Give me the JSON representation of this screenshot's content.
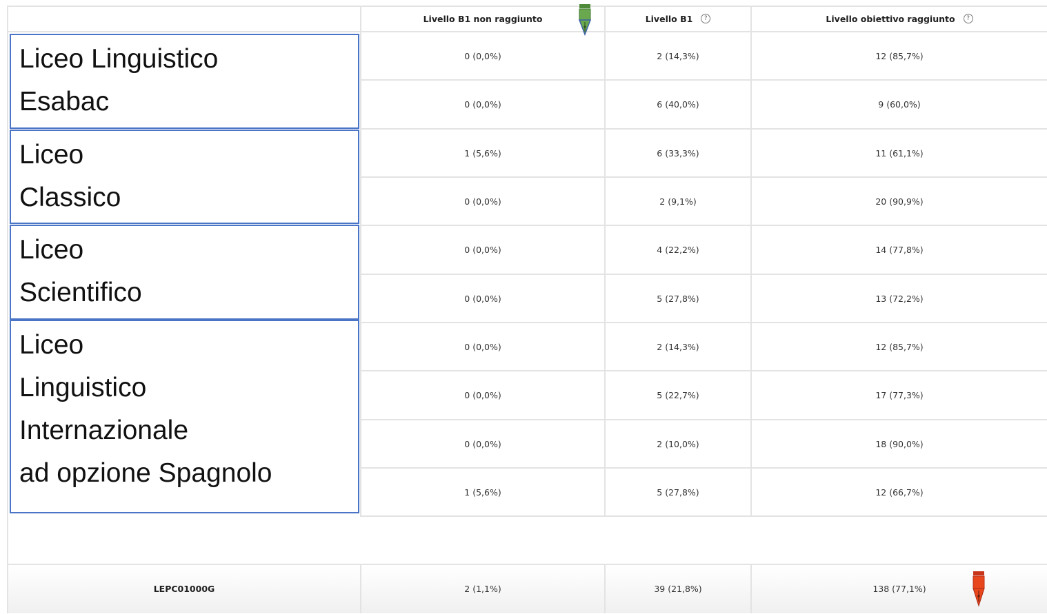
{
  "columns": {
    "col1": "Livello B1 non raggiunto",
    "col2": "Livello B1",
    "col3": "Livello obiettivo raggiunto",
    "help_glyph": "?"
  },
  "groups": [
    {
      "lines": [
        "Liceo Linguistico",
        "Esabac"
      ]
    },
    {
      "lines": [
        "Liceo",
        "Classico"
      ]
    },
    {
      "lines": [
        "Liceo",
        "Scientifico"
      ]
    },
    {
      "lines": [
        "Liceo",
        "Linguistico",
        "Internazionale",
        "ad opzione Spagnolo"
      ]
    }
  ],
  "rows": [
    {
      "c1": "0 (0,0%)",
      "c2": "2 (14,3%)",
      "c3": "12 (85,7%)"
    },
    {
      "c1": "0 (0,0%)",
      "c2": "6 (40,0%)",
      "c3": "9 (60,0%)"
    },
    {
      "c1": "1 (5,6%)",
      "c2": "6 (33,3%)",
      "c3": "11 (61,1%)"
    },
    {
      "c1": "0 (0,0%)",
      "c2": "2 (9,1%)",
      "c3": "20 (90,9%)"
    },
    {
      "c1": "0 (0,0%)",
      "c2": "4 (22,2%)",
      "c3": "14 (77,8%)"
    },
    {
      "c1": "0 (0,0%)",
      "c2": "5 (27,8%)",
      "c3": "13 (72,2%)"
    },
    {
      "c1": "0 (0,0%)",
      "c2": "2 (14,3%)",
      "c3": "12 (85,7%)"
    },
    {
      "c1": "0 (0,0%)",
      "c2": "5 (22,7%)",
      "c3": "17 (77,3%)"
    },
    {
      "c1": "0 (0,0%)",
      "c2": "2 (10,0%)",
      "c3": "18 (90,0%)"
    },
    {
      "c1": "1 (5,6%)",
      "c2": "5 (27,8%)",
      "c3": "12 (66,7%)"
    }
  ],
  "total": {
    "label": "LEPC01000G",
    "c1": "2 (1,1%)",
    "c2": "39 (21,8%)",
    "c3": "138 (77,1%)"
  },
  "colors": {
    "grid": "#e3e3e3",
    "box_border": "#4a74c6",
    "pen_green": "#6aa84f",
    "pen_red": "#e8461c"
  },
  "icons": [
    "green-pen-icon",
    "red-pen-icon",
    "help-icon"
  ]
}
